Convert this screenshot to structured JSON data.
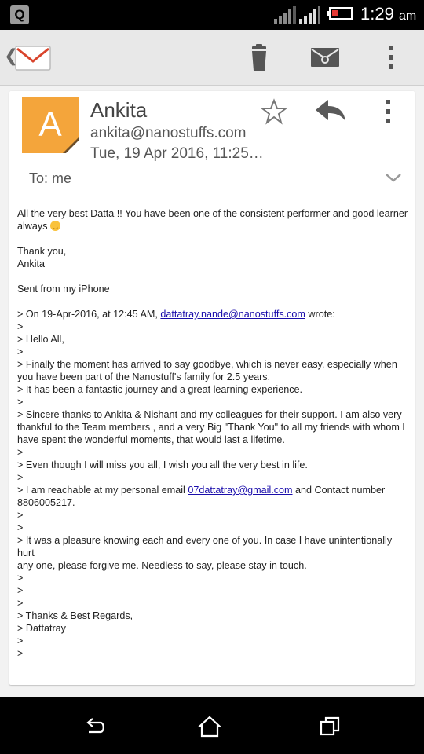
{
  "status_bar": {
    "app_icon_letter": "Q",
    "time": "1:29",
    "ampm": "am",
    "battery_color": "#e53935"
  },
  "toolbar": {
    "back_icon": "chevron-left-icon",
    "app_icon": "gmail-envelope-icon",
    "actions": [
      "delete-icon",
      "mark-unread-icon",
      "overflow-menu-icon"
    ]
  },
  "message": {
    "avatar_letter": "A",
    "avatar_color": "#f4a53b",
    "sender_name": "Ankita",
    "sender_email": "ankita@nanostuffs.com",
    "date": "Tue, 19 Apr 2016, 11:25…",
    "to_line": "To: me",
    "body": {
      "greeting_line1": "All the very best Datta !! You have been one of the consistent performer and good learner",
      "greeting_line2": "always",
      "thanks": "Thank you,",
      "signoff": "Ankita",
      "sent_from": "Sent from my iPhone",
      "quote_header_prefix": "> On 19-Apr-2016, at 12:45 AM, ",
      "quote_header_email": "dattatray.nande@nanostuffs.com",
      "quote_header_suffix": " wrote:",
      "quote_marker": ">",
      "q_hello": "> Hello All,",
      "q_finally_1": "> Finally the moment has arrived to say goodbye, which is never easy, especially when",
      "q_finally_2": "you have been part of the Nanostuff's family for 2.5 years.",
      "q_journey": "> It has been a fantastic journey and a great learning experience.",
      "q_thanks_1": "> Sincere thanks to Ankita & Nishant and my colleagues for their support. I am also very",
      "q_thanks_2": "thankful to the Team members , and a very Big \"Thank You\" to all my friends with whom I",
      "q_thanks_3": "have spent the wonderful moments, that would last a lifetime.",
      "q_miss": "> Even though I will miss you all, I wish you all the very best in life.",
      "q_reach_prefix": "> I am reachable at my personal email ",
      "q_reach_email": "07dattatray@gmail.com",
      "q_reach_suffix": " and Contact number",
      "q_reach_2": "8806005217.",
      "q_pleasure_1": "> It was a pleasure knowing each and every one of you. In case I have unintentionally hurt",
      "q_pleasure_2": "any one, please forgive me. Needless to say, please stay in touch.",
      "q_regards": "> Thanks & Best Regards,",
      "q_name": "> Dattatray"
    },
    "link_color": "#1a0dab"
  },
  "nav_bar": {
    "buttons": [
      "back-icon",
      "home-icon",
      "recents-icon"
    ]
  }
}
